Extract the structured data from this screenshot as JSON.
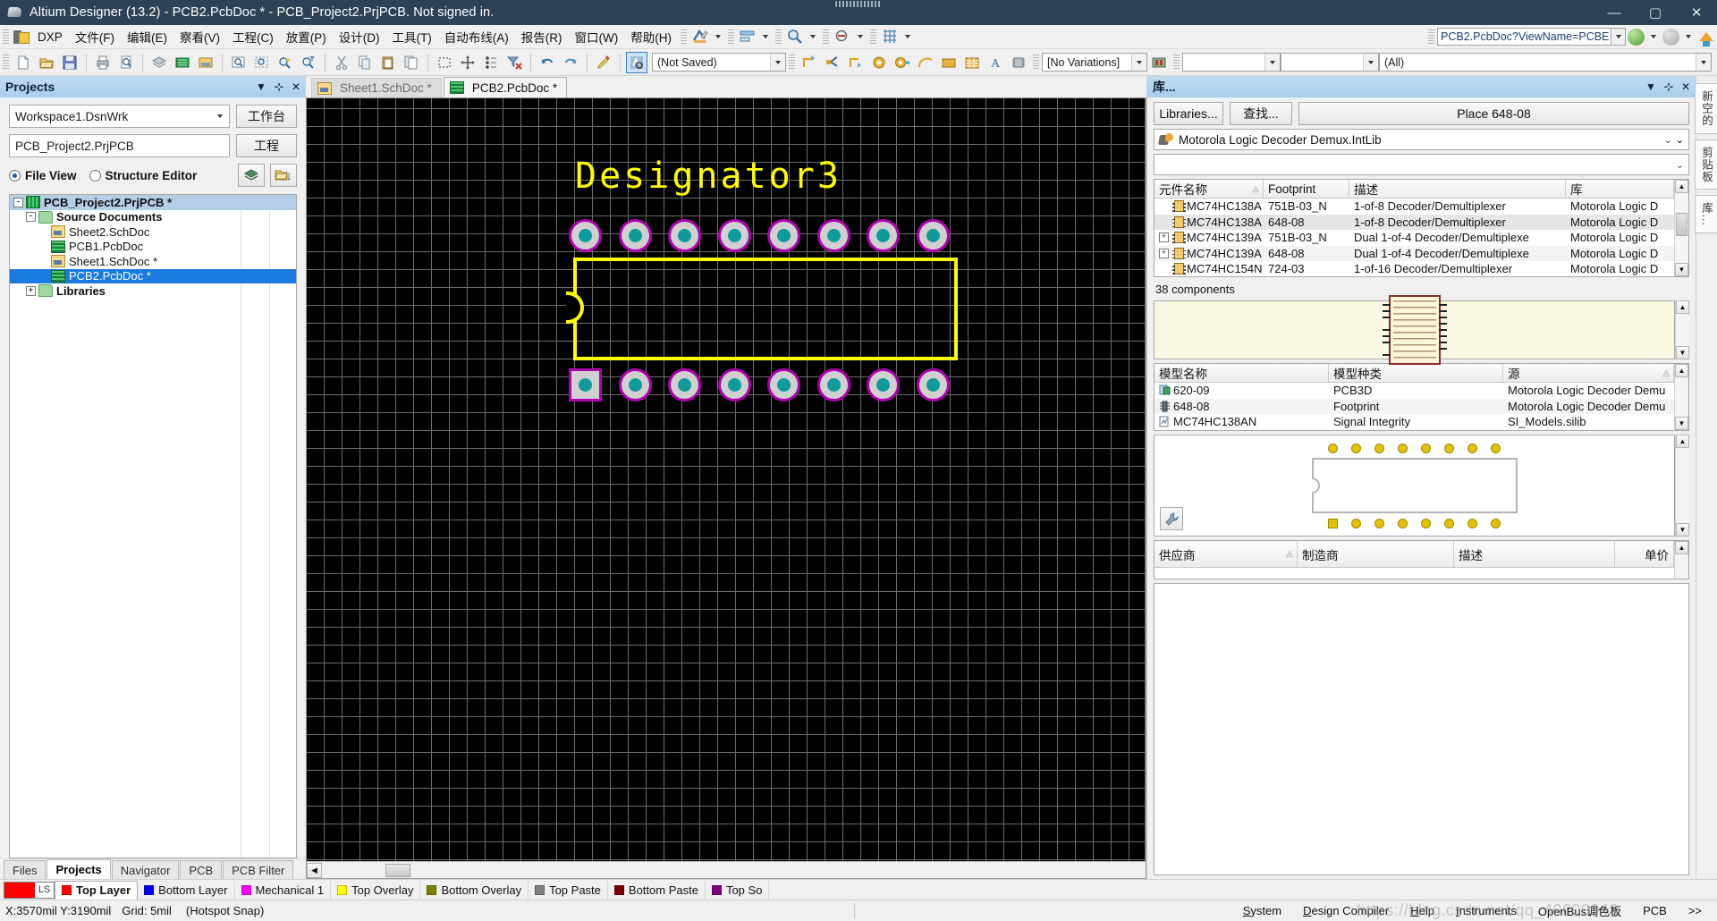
{
  "window": {
    "title": "Altium Designer (13.2) - PCB2.PcbDoc * - PCB_Project2.PrjPCB. Not signed in.",
    "minimize": "—",
    "maximize": "▢",
    "close": "✕"
  },
  "menu": {
    "dxp": "DXP",
    "items": [
      "文件(F)",
      "编辑(E)",
      "察看(V)",
      "工程(C)",
      "放置(P)",
      "设计(D)",
      "工具(T)",
      "自动布线(A)",
      "报告(R)",
      "窗口(W)",
      "帮助(H)"
    ],
    "address_value": "PCB2.PcbDoc?ViewName=PCBE"
  },
  "toolbar": {
    "not_saved": "(Not Saved)",
    "no_variations": "[No Variations]",
    "filter_all": "(All)",
    "empty_combo_1": "",
    "empty_combo_2": ""
  },
  "projects_panel": {
    "title": "Projects",
    "workspace_value": "Workspace1.DsnWrk",
    "workspace_button": "工作台",
    "project_value": "PCB_Project2.PrjPCB",
    "project_button": "工程",
    "file_view": "File View",
    "structure_editor": "Structure Editor",
    "tree": [
      {
        "label": "PCB_Project2.PrjPCB *",
        "icon": "project-icon",
        "indent": 0,
        "expander": "-",
        "selected": true,
        "bold": true
      },
      {
        "label": "Source Documents",
        "icon": "folder-icon",
        "indent": 1,
        "expander": "-",
        "selected": false,
        "bold": true
      },
      {
        "label": "Sheet2.SchDoc",
        "icon": "schematic-icon",
        "indent": 2,
        "expander": "",
        "selected": false,
        "bold": false
      },
      {
        "label": "PCB1.PcbDoc",
        "icon": "pcb-icon",
        "indent": 2,
        "expander": "",
        "selected": false,
        "bold": false
      },
      {
        "label": "Sheet1.SchDoc *",
        "icon": "schematic-icon",
        "indent": 2,
        "expander": "",
        "selected": false,
        "bold": false
      },
      {
        "label": "PCB2.PcbDoc *",
        "icon": "pcb-icon",
        "indent": 2,
        "expander": "",
        "selected": true,
        "bold": false
      },
      {
        "label": "Libraries",
        "icon": "folder-icon",
        "indent": 1,
        "expander": "+",
        "selected": false,
        "bold": true
      }
    ],
    "tabs": [
      {
        "label": "Files",
        "active": false
      },
      {
        "label": "Projects",
        "active": true
      },
      {
        "label": "Navigator",
        "active": false
      },
      {
        "label": "PCB",
        "active": false
      },
      {
        "label": "PCB Filter",
        "active": false
      }
    ]
  },
  "documents": {
    "tabs": [
      {
        "label": "Sheet1.SchDoc *",
        "icon": "schematic-icon",
        "active": false
      },
      {
        "label": "PCB2.PcbDoc *",
        "icon": "pcb-icon",
        "active": true
      }
    ]
  },
  "canvas": {
    "designator": "Designator3",
    "designator_color": "#ffff00",
    "outline_color": "#ffff00",
    "pad_ring_color": "#b000b0",
    "pad_color": "#d0d0d0",
    "pad_hole_color": "#0f9b9b",
    "background": "#000000",
    "grid_color": "#6d6d6d",
    "pad_count_top": 8,
    "pad_count_bottom": 8
  },
  "libraries_panel": {
    "title": "库...",
    "libraries_button": "Libraries...",
    "search_button": "查找...",
    "place_button": "Place 648-08",
    "selected_library": "Motorola Logic Decoder Demux.IntLib",
    "filter_value": "",
    "components_grid": {
      "columns": [
        "元件名称",
        "Footprint",
        "描述",
        "库"
      ],
      "rows": [
        {
          "expander": "",
          "name": "MC74HC138A",
          "footprint": "751B-03_N",
          "description": "1-of-8 Decoder/Demultiplexer",
          "library": "Motorola Logic D",
          "selected": false
        },
        {
          "expander": "",
          "name": "MC74HC138A",
          "footprint": "648-08",
          "description": "1-of-8 Decoder/Demultiplexer",
          "library": "Motorola Logic D",
          "selected": true
        },
        {
          "expander": "+",
          "name": "MC74HC139A",
          "footprint": "751B-03_N",
          "description": "Dual 1-of-4 Decoder/Demultiplexe",
          "library": "Motorola Logic D",
          "selected": false
        },
        {
          "expander": "+",
          "name": "MC74HC139A",
          "footprint": "648-08",
          "description": "Dual 1-of-4 Decoder/Demultiplexe",
          "library": "Motorola Logic D",
          "selected": false
        },
        {
          "expander": "",
          "name": "MC74HC154N",
          "footprint": "724-03",
          "description": "1-of-16 Decoder/Demultiplexer",
          "library": "Motorola Logic D",
          "selected": false
        }
      ]
    },
    "component_count": "38 components",
    "models_grid": {
      "columns": [
        "模型名称",
        "模型种类",
        "源"
      ],
      "rows": [
        {
          "name": "620-09",
          "kind": "PCB3D",
          "source": "Motorola Logic Decoder Demu",
          "icon": "pcb3d-icon"
        },
        {
          "name": "648-08",
          "kind": "Footprint",
          "source": "Motorola Logic Decoder Demu",
          "icon": "footprint-icon"
        },
        {
          "name": "MC74HC138AN",
          "kind": "Signal Integrity",
          "source": "SI_Models.silib",
          "icon": "signal-integrity-icon"
        }
      ]
    },
    "supplier_grid": {
      "columns": [
        "供应商",
        "制造商",
        "描述",
        "单价"
      ],
      "rows": []
    }
  },
  "vertical_tabs": [
    {
      "label": "新空的"
    },
    {
      "label": "剪贴板"
    },
    {
      "label": "库..."
    }
  ],
  "layer_bar": {
    "ls_label": "LS",
    "ls_color": "#ff0000",
    "layers": [
      {
        "label": "Top Layer",
        "color": "#ff0000",
        "active": true
      },
      {
        "label": "Bottom Layer",
        "color": "#0000ff",
        "active": false
      },
      {
        "label": "Mechanical 1",
        "color": "#ff00ff",
        "active": false
      },
      {
        "label": "Top Overlay",
        "color": "#ffff00",
        "active": false
      },
      {
        "label": "Bottom Overlay",
        "color": "#808000",
        "active": false
      },
      {
        "label": "Top Paste",
        "color": "#808080",
        "active": false
      },
      {
        "label": "Bottom Paste",
        "color": "#800000",
        "active": false
      },
      {
        "label": "Top So",
        "color": "#800080",
        "active": false
      }
    ]
  },
  "status_bar": {
    "coords": "X:3570mil Y:3190mil",
    "grid": "Grid: 5mil",
    "snap": "(Hotspot Snap)",
    "watermark": "https://blog.csdn.net/qq_40600943",
    "buttons": [
      {
        "label": "System",
        "accel": "S"
      },
      {
        "label": "Design Compiler",
        "accel": "D"
      },
      {
        "label": "Help",
        "accel": "H"
      },
      {
        "label": "Instruments",
        "accel": "I"
      },
      {
        "label": "OpenBus调色板",
        "accel": ""
      },
      {
        "label": "PCB",
        "accel": ""
      },
      {
        "label": ">>",
        "accel": ""
      }
    ]
  }
}
